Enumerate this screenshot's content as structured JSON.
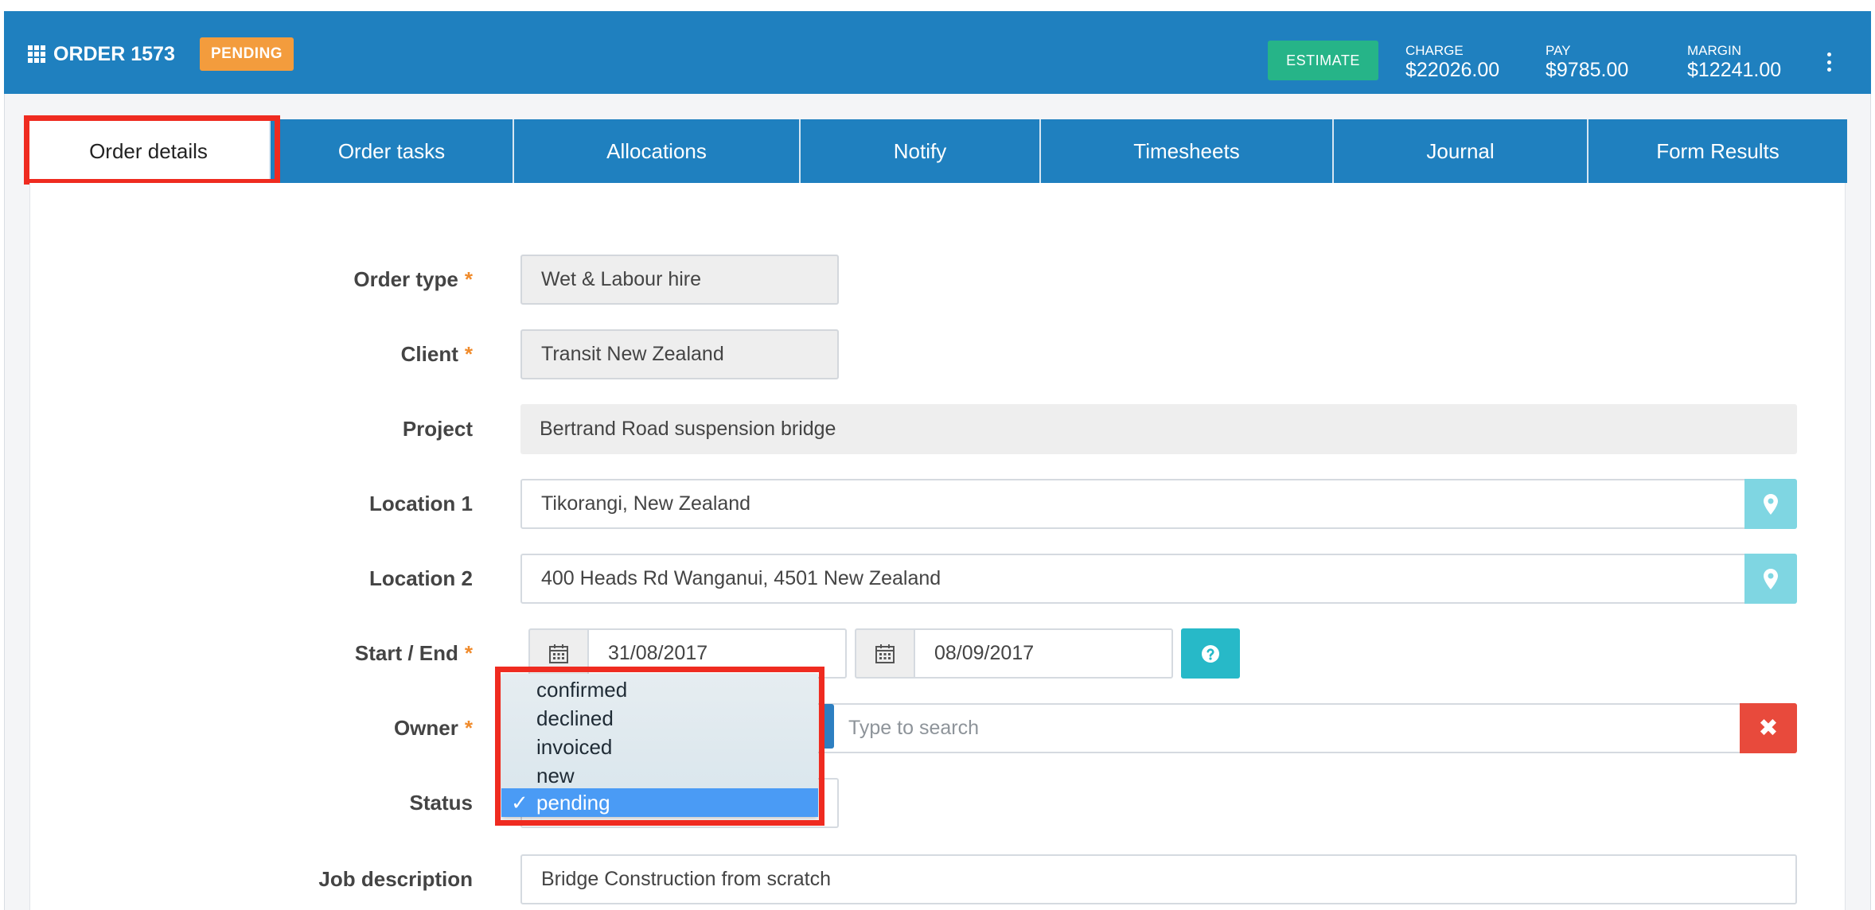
{
  "header": {
    "order_title": "ORDER 1573",
    "status_badge": "PENDING",
    "estimate_label": "ESTIMATE",
    "charge": {
      "label": "CHARGE",
      "value": "$22026.00"
    },
    "pay": {
      "label": "PAY",
      "value": "$9785.00"
    },
    "margin": {
      "label": "MARGIN",
      "value": "$12241.00"
    },
    "icons": {
      "grid": "grid-icon",
      "menu": "kebab-menu-icon"
    }
  },
  "tabs": [
    {
      "label": "Order details",
      "active": true
    },
    {
      "label": "Order tasks"
    },
    {
      "label": "Allocations"
    },
    {
      "label": "Notify"
    },
    {
      "label": "Timesheets"
    },
    {
      "label": "Journal"
    },
    {
      "label": "Form Results"
    }
  ],
  "form": {
    "order_type": {
      "label": "Order type",
      "value": "Wet & Labour hire"
    },
    "client": {
      "label": "Client",
      "value": "Transit New Zealand"
    },
    "project": {
      "label": "Project",
      "value": "Bertrand Road suspension bridge"
    },
    "location1": {
      "label": "Location 1",
      "value": "Tikorangi, New Zealand"
    },
    "location2": {
      "label": "Location 2",
      "value": "400 Heads Rd Wanganui, 4501 New Zealand"
    },
    "start_end": {
      "label": "Start / End",
      "start": "31/08/2017",
      "end": "08/09/2017"
    },
    "owner": {
      "label": "Owner",
      "placeholder": "Type to search",
      "clear_glyph": "✖"
    },
    "status": {
      "label": "Status",
      "options": [
        "confirmed",
        "declined",
        "invoiced",
        "new",
        "pending"
      ],
      "selected": "pending",
      "check_glyph": "✓"
    },
    "job_description": {
      "label": "Job description",
      "value": "Bridge Construction from scratch"
    },
    "required_marker": "*"
  },
  "colors": {
    "header_bg": "#1f80bf",
    "badge": "#f39c3d",
    "estimate": "#26b488",
    "highlight": "#ef2b20",
    "map_button": "#7fd6e2",
    "help_button": "#27b9c8",
    "clear_button": "#e84a3c",
    "selected_option": "#4a9bf5"
  }
}
